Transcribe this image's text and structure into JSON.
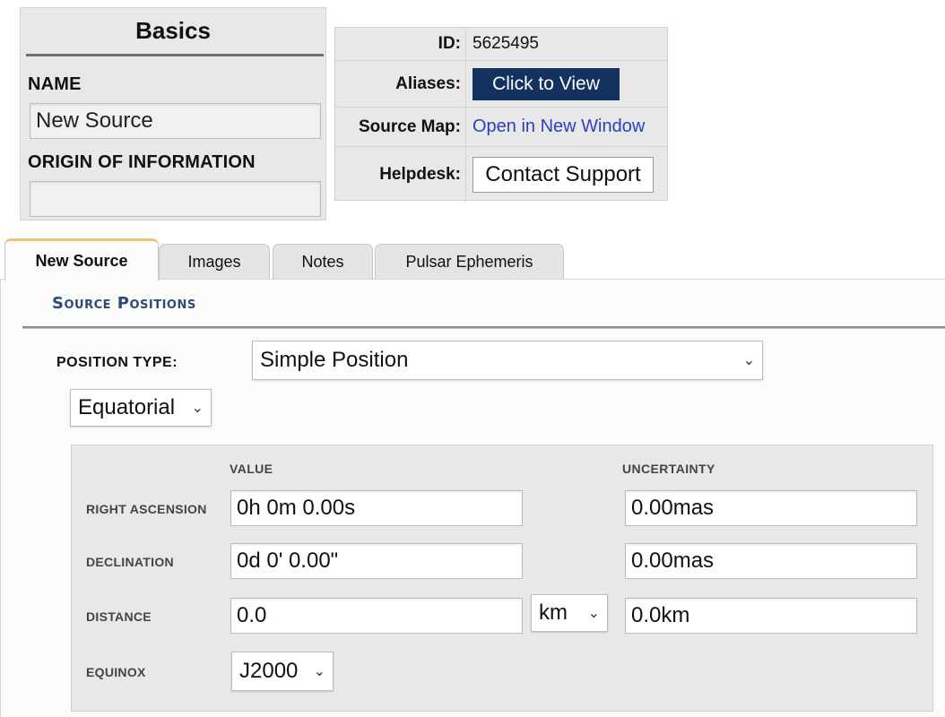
{
  "basics": {
    "title": "Basics",
    "name_label": "NAME",
    "name_value": "New Source",
    "origin_label": "ORIGIN OF INFORMATION",
    "origin_value": ""
  },
  "info": {
    "id_label": "ID:",
    "id_value": "5625495",
    "aliases_label": "Aliases:",
    "aliases_button": "Click to View",
    "source_map_label": "Source Map:",
    "source_map_link": "Open in New Window",
    "helpdesk_label": "Helpdesk:",
    "helpdesk_button": "Contact Support"
  },
  "tabs": [
    {
      "label": "New Source",
      "active": true
    },
    {
      "label": "Images",
      "active": false
    },
    {
      "label": "Notes",
      "active": false
    },
    {
      "label": "Pulsar Ephemeris",
      "active": false
    }
  ],
  "content": {
    "section_title": "Source Positions",
    "position_type_label": "POSITION TYPE:",
    "position_type_value": "Simple Position",
    "coordinate_system_value": "Equatorial",
    "value_header": "VALUE",
    "uncertainty_header": "UNCERTAINTY",
    "rows": {
      "ra": {
        "label": "RIGHT ASCENSION",
        "value": "0h 0m 0.00s",
        "uncertainty": "0.00mas"
      },
      "dec": {
        "label": "DECLINATION",
        "value": "0d 0' 0.00\"",
        "uncertainty": "0.00mas"
      },
      "distance": {
        "label": "DISTANCE",
        "value": "0.0",
        "unit": "km",
        "uncertainty": "0.0km"
      },
      "equinox": {
        "label": "EQUINOX",
        "value": "J2000"
      }
    }
  },
  "colors": {
    "button_dark": "#14325f",
    "link": "#2b3fbf",
    "section_title": "#2d4a78",
    "active_tab_accent": "#f1c27a"
  },
  "icons": {
    "dropdown": "chevron-down-icon"
  }
}
